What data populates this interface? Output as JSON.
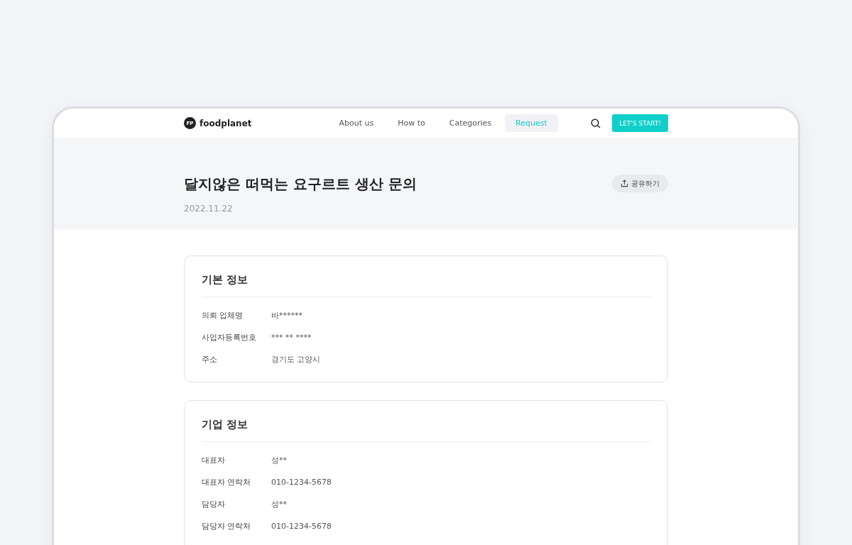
{
  "header": {
    "logo_mark": "FP",
    "logo_text": "foodplanet",
    "nav": [
      {
        "label": "About us",
        "selected": false
      },
      {
        "label": "How to",
        "selected": false
      },
      {
        "label": "Categories",
        "selected": false
      },
      {
        "label": "Request",
        "selected": true
      }
    ],
    "cta": "LET'S START!"
  },
  "hero": {
    "title": "달지않은 떠먹는 요구르트 생산 문의",
    "date": "2022.11.22",
    "share": "공유하기"
  },
  "sections": [
    {
      "title": "기본 정보",
      "rows": [
        {
          "label": "의뢰 업체명",
          "value": "바******"
        },
        {
          "label": "사업자등록번호",
          "value": "*** ** ****"
        },
        {
          "label": "주소",
          "value": "경기도 고양시"
        }
      ]
    },
    {
      "title": "기업 정보",
      "rows": [
        {
          "label": "대표자",
          "value": "성**"
        },
        {
          "label": "대표자 연락처",
          "value": "010-1234-5678"
        },
        {
          "label": "담당자",
          "value": "성**"
        },
        {
          "label": "담당자 연락처",
          "value": "010-1234-5678"
        }
      ]
    }
  ]
}
